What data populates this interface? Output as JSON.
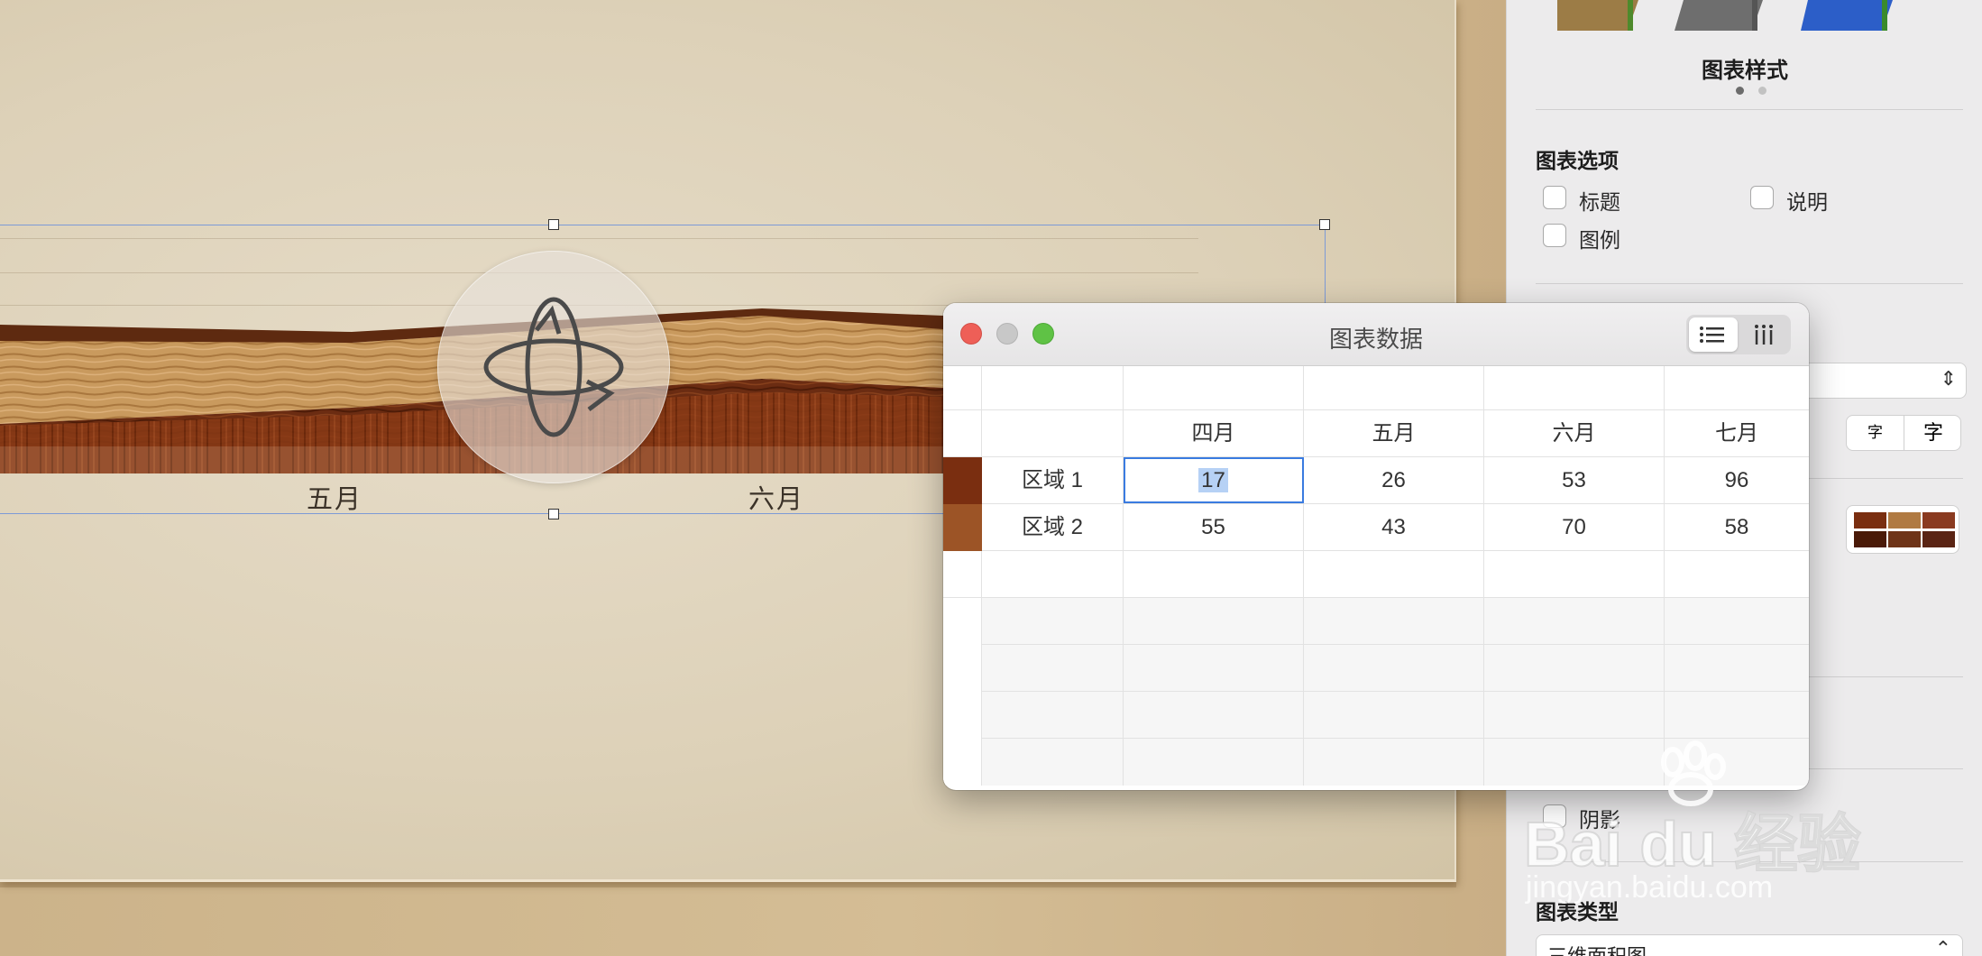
{
  "canvas": {
    "axis_labels": [
      "五月",
      "六月"
    ]
  },
  "inspector": {
    "chart_style_label": "图表样式",
    "chart_options_heading": "图表选项",
    "options": {
      "title": "标题",
      "caption": "说明",
      "legend": "图例"
    },
    "font_buttons": [
      "字",
      "字"
    ],
    "shadow_label": "阴影",
    "chart_type_heading": "图表类型",
    "chart_type_value": "三维面积图"
  },
  "data_window": {
    "title": "图表数据",
    "columns": [
      "四月",
      "五月",
      "六月",
      "七月"
    ],
    "rows": [
      {
        "label": "区域 1",
        "values": [
          "17",
          "26",
          "53",
          "96"
        ]
      },
      {
        "label": "区域 2",
        "values": [
          "55",
          "43",
          "70",
          "58"
        ]
      }
    ],
    "row_colors": [
      "#7a2e10",
      "#9c5426"
    ]
  },
  "watermark": {
    "brand": "Bai du 经验",
    "url": "jingyan.baidu.com"
  },
  "colors": {
    "selection": "#7d9ad6",
    "accent": "#3a7be0",
    "close": "#ee5f57",
    "minimize": "#c8c8c8",
    "zoom": "#5fc245"
  }
}
